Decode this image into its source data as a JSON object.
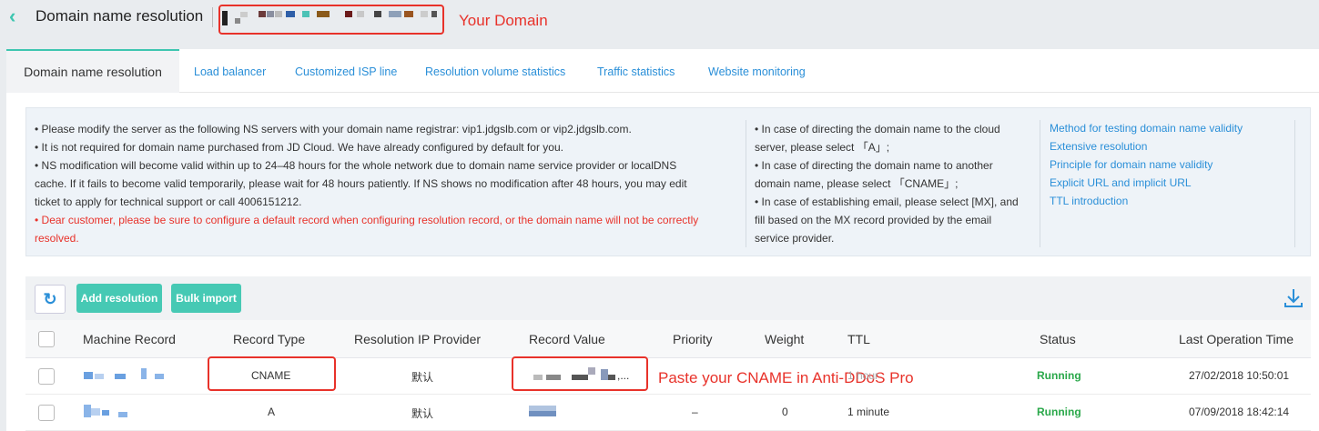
{
  "header": {
    "back_icon": "chevron-left-icon",
    "title": "Domain name resolution",
    "annotation": "Your Domain"
  },
  "tabs": [
    {
      "label": "Domain name resolution",
      "active": true
    },
    {
      "label": "Load balancer"
    },
    {
      "label": "Customized ISP line"
    },
    {
      "label": "Resolution volume statistics"
    },
    {
      "label": "Traffic statistics"
    },
    {
      "label": "Website monitoring"
    }
  ],
  "notice": {
    "col1": {
      "line1": "• Please modify the server as the following NS servers with your domain name registrar: vip1.jdgslb.com or vip2.jdgslb.com.",
      "line2": "• It is not required for domain name purchased from JD Cloud. We have already configured by default for you.",
      "line3a": "• NS modification will become valid within up to 24–48 hours for the whole network due to domain name service provider or localDNS",
      "line3b": "cache. If it fails to become valid temporarily, please wait for 48 hours patiently. If NS shows no modification after 48 hours, you may edit",
      "line3c": "ticket to apply for technical support or call 4006151212.",
      "warn_a": "• Dear customer, please be sure to configure a default record when configuring resolution record, or the domain name will not be correctly",
      "warn_b": "resolved."
    },
    "col2": {
      "l1": "•  In case of directing the domain name to the cloud",
      "l2": "server, please select 「A」;",
      "l3": "•  In case of directing the domain name to another",
      "l4": "domain name, please select 「CNAME」;",
      "l5": "•  In case of establishing email, please select [MX], and",
      "l6": "fill based on the MX record provided by the email",
      "l7": "service provider."
    },
    "links": [
      "Method for testing domain name validity",
      "Extensive resolution",
      "Principle for domain name validity",
      "Explicit URL and implicit URL",
      "TTL introduction"
    ]
  },
  "toolbar": {
    "refresh_icon": "refresh-icon",
    "add_label": "Add resolution",
    "bulk_label": "Bulk import",
    "download_icon": "download-icon"
  },
  "table": {
    "headers": [
      "Machine Record",
      "Record Type",
      "Resolution IP Provider",
      "Record Value",
      "Priority",
      "Weight",
      "TTL",
      "Status",
      "Last Operation Time"
    ],
    "rows": [
      {
        "record_type": "CNAME",
        "provider": "默认",
        "record_value_suffix": ",...",
        "priority": "",
        "weight": "",
        "ttl": "1 hour",
        "status": "Running",
        "time": "27/02/2018 10:50:01"
      },
      {
        "record_type": "A",
        "provider": "默认",
        "record_value_suffix": "",
        "priority": "–",
        "weight": "0",
        "ttl": "1 minute",
        "status": "Running",
        "time": "07/09/2018 18:42:14"
      }
    ],
    "annotation": "Paste your CNAME in Anti-DDoS Pro"
  },
  "colors": {
    "accent": "#3ec6b0",
    "link": "#2a8fd8",
    "annotation": "#e8322a",
    "running": "#2aa84a"
  }
}
